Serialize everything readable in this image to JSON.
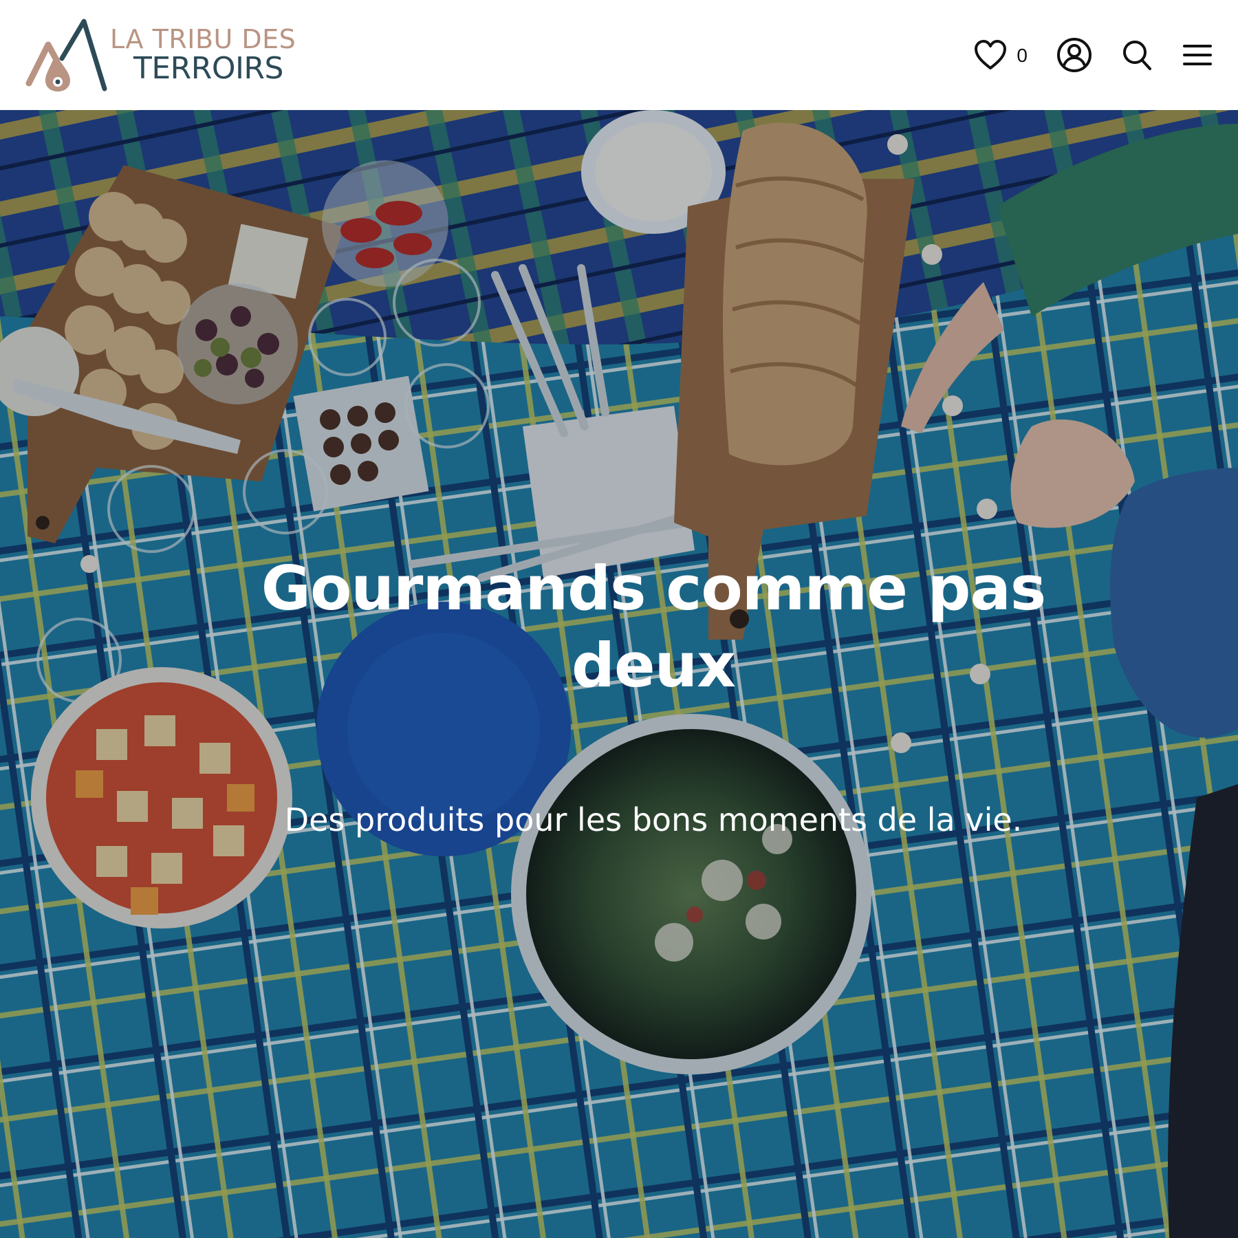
{
  "header": {
    "logo": {
      "line1": "LA TRIBU DES",
      "line2": "TERROIRS",
      "colors": {
        "primary": "#b99483",
        "secondary": "#2d4a57"
      }
    },
    "wishlist": {
      "icon": "heart-icon",
      "count": "0"
    },
    "account": {
      "icon": "user-circle-icon"
    },
    "search": {
      "icon": "search-icon"
    },
    "menu": {
      "icon": "hamburger-menu-icon"
    }
  },
  "hero": {
    "title": "Gourmands comme pas deux",
    "subtitle": "Des produits pour les bons moments de la vie.",
    "image": "picnic-blanket-food-photo",
    "colors": {
      "text": "#ffffff",
      "blanket": "#1e7fa6"
    }
  }
}
